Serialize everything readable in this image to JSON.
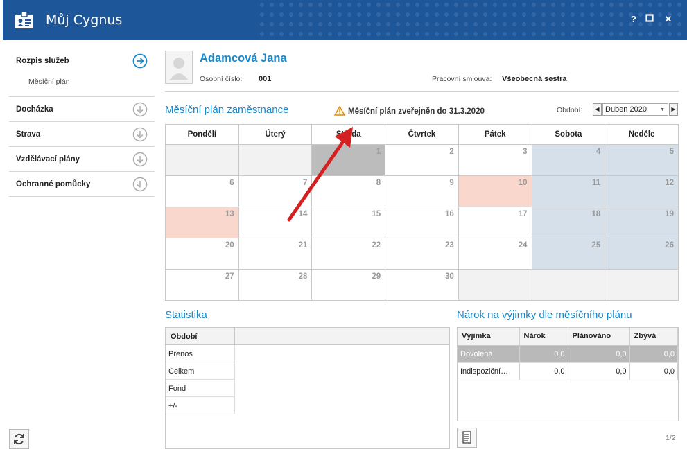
{
  "window": {
    "title": "Můj Cygnus",
    "help": "?",
    "maximize": "□",
    "close": "✕"
  },
  "sidebar": {
    "items": [
      {
        "label": "Rozpis služeb",
        "sub": "Měsíční plán",
        "expanded": true
      },
      {
        "label": "Docházka"
      },
      {
        "label": "Strava"
      },
      {
        "label": "Vzdělávací plány"
      },
      {
        "label": "Ochranné pomůcky"
      }
    ]
  },
  "employee": {
    "name": "Adamcová Jana",
    "id_label": "Osobní číslo:",
    "id_value": "001",
    "contract_label": "Pracovní smlouva:",
    "contract_value": "Všeobecná sestra"
  },
  "plan": {
    "title": "Měsíční plán zaměstnance",
    "notice": "Měsíční plán zveřejněn do 31.3.2020",
    "period_label": "Období:",
    "period_value": "Duben 2020",
    "weekdays": [
      "Pondělí",
      "Úterý",
      "Středa",
      "Čtvrtek",
      "Pátek",
      "Sobota",
      "Neděle"
    ],
    "weeks": [
      [
        {
          "d": "",
          "t": "empty"
        },
        {
          "d": "",
          "t": "empty"
        },
        {
          "d": "1",
          "t": "today"
        },
        {
          "d": "2",
          "t": ""
        },
        {
          "d": "3",
          "t": ""
        },
        {
          "d": "4",
          "t": "weekend"
        },
        {
          "d": "5",
          "t": "weekend"
        }
      ],
      [
        {
          "d": "6",
          "t": ""
        },
        {
          "d": "7",
          "t": ""
        },
        {
          "d": "8",
          "t": ""
        },
        {
          "d": "9",
          "t": ""
        },
        {
          "d": "10",
          "t": "absence"
        },
        {
          "d": "11",
          "t": "weekend"
        },
        {
          "d": "12",
          "t": "weekend"
        }
      ],
      [
        {
          "d": "13",
          "t": "absence"
        },
        {
          "d": "14",
          "t": ""
        },
        {
          "d": "15",
          "t": ""
        },
        {
          "d": "16",
          "t": ""
        },
        {
          "d": "17",
          "t": ""
        },
        {
          "d": "18",
          "t": "weekend"
        },
        {
          "d": "19",
          "t": "weekend"
        }
      ],
      [
        {
          "d": "20",
          "t": ""
        },
        {
          "d": "21",
          "t": ""
        },
        {
          "d": "22",
          "t": ""
        },
        {
          "d": "23",
          "t": ""
        },
        {
          "d": "24",
          "t": ""
        },
        {
          "d": "25",
          "t": "weekend"
        },
        {
          "d": "26",
          "t": "weekend"
        }
      ],
      [
        {
          "d": "27",
          "t": ""
        },
        {
          "d": "28",
          "t": ""
        },
        {
          "d": "29",
          "t": ""
        },
        {
          "d": "30",
          "t": ""
        },
        {
          "d": "",
          "t": "empty"
        },
        {
          "d": "",
          "t": "empty"
        },
        {
          "d": "",
          "t": "empty"
        }
      ]
    ]
  },
  "statistika": {
    "title": "Statistika",
    "header": "Období",
    "rows": [
      "Přenos",
      "Celkem",
      "Fond",
      "+/-"
    ]
  },
  "narok": {
    "title": "Nárok na výjimky dle měsíčního plánu",
    "columns": [
      "Výjimka",
      "Nárok",
      "Plánováno",
      "Zbývá"
    ],
    "rows": [
      [
        "Dovolená",
        "0,0",
        "0,0",
        "0,0"
      ],
      [
        "Indispoziční…",
        "0,0",
        "0,0",
        "0,0"
      ]
    ],
    "pager": "1/2"
  },
  "colors": {
    "accent": "#1a88c9",
    "titlebar": "#1e5799",
    "weekend": "#d5e0eb",
    "absence": "#f9d7cd",
    "today": "#bcbcbc"
  }
}
